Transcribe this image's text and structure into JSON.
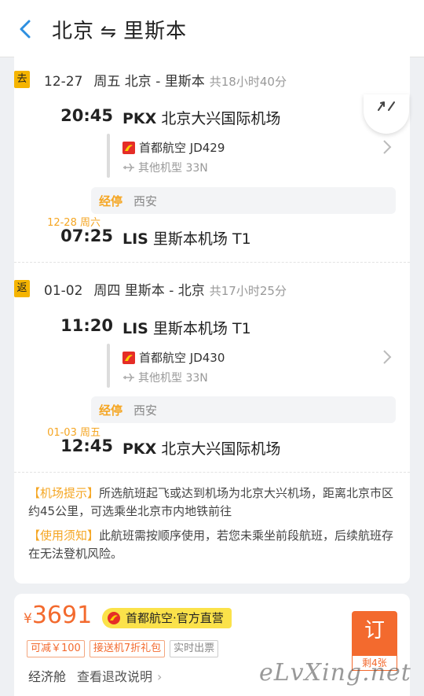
{
  "header": {
    "origin": "北京",
    "swap_symbol": "⇋",
    "destination": "里斯本"
  },
  "outbound": {
    "tag": "去",
    "date": "12-27",
    "summary": "周五 北京 - 里斯本",
    "total": "共18小时40分",
    "depart_time": "20:45",
    "depart_code": "PKX",
    "depart_airport": "北京大兴国际机场",
    "airline": "首都航空 JD429",
    "aircraft": "其他机型 33N",
    "stop_label": "经停",
    "stop_city": "西安",
    "arrive_day": "12-28 周六",
    "arrive_time": "07:25",
    "arrive_code": "LIS",
    "arrive_airport": "里斯本机场 T1"
  },
  "return": {
    "tag": "返",
    "date": "01-02",
    "summary": "周四 里斯本 - 北京",
    "total": "共17小时25分",
    "depart_time": "11:20",
    "depart_code": "LIS",
    "depart_airport": "里斯本机场 T1",
    "airline": "首都航空 JD430",
    "aircraft": "其他机型 33N",
    "stop_label": "经停",
    "stop_city": "西安",
    "arrive_day": "01-03 周五",
    "arrive_time": "12:45",
    "arrive_code": "PKX",
    "arrive_airport": "北京大兴国际机场"
  },
  "notices": [
    {
      "title": "【机场提示】",
      "text": "所选航班起飞或达到机场为北京大兴机场，距离北京市区约45公里，可选乘坐北京市内地铁前往"
    },
    {
      "title": "【使用须知】",
      "text": "此航班需按顺序使用，若您未乘坐前段航班，后续航班存在无法登机风险。"
    }
  ],
  "offer": {
    "currency": "¥",
    "price": "3691",
    "official_label": "首都航空·官方直营",
    "chips": [
      "可减￥100",
      "接送机7折礼包",
      "实时出票"
    ],
    "cabin": "经济舱",
    "rules_link": "查看退改说明",
    "book_label": "订",
    "remaining": "剩4张"
  },
  "watermark": "eLvXing.net",
  "colors": {
    "accent": "#f5a623",
    "price": "#f36a2e",
    "tag": "#f5b400",
    "back": "#2d8fe0"
  }
}
